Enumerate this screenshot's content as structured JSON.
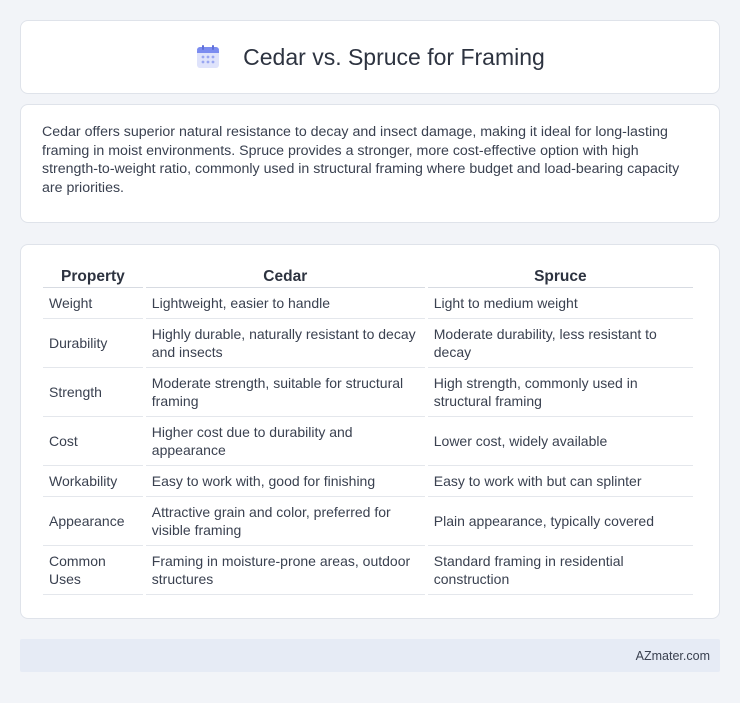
{
  "header": {
    "title": "Cedar vs. Spruce for Framing",
    "icon": "calendar-icon",
    "icon_colors": {
      "top": "#7b8cf0",
      "body": "#dfe3fb",
      "dots": "#9aa7f2"
    }
  },
  "summary": {
    "text": "Cedar offers superior natural resistance to decay and insect damage, making it ideal for long-lasting framing in moist environments. Spruce provides a stronger, more cost-effective option with high strength-to-weight ratio, commonly used in structural framing where budget and load-bearing capacity are priorities."
  },
  "table": {
    "headers": [
      "Property",
      "Cedar",
      "Spruce"
    ],
    "rows": [
      [
        "Weight",
        "Lightweight, easier to handle",
        "Light to medium weight"
      ],
      [
        "Durability",
        "Highly durable, naturally resistant to decay and insects",
        "Moderate durability, less resistant to decay"
      ],
      [
        "Strength",
        "Moderate strength, suitable for structural framing",
        "High strength, commonly used in structural framing"
      ],
      [
        "Cost",
        "Higher cost due to durability and appearance",
        "Lower cost, widely available"
      ],
      [
        "Workability",
        "Easy to work with, good for finishing",
        "Easy to work with but can splinter"
      ],
      [
        "Appearance",
        "Attractive grain and color, preferred for visible framing",
        "Plain appearance, typically covered"
      ],
      [
        "Common Uses",
        "Framing in moisture-prone areas, outdoor structures",
        "Standard framing in residential construction"
      ]
    ]
  },
  "footer": {
    "site": "AZmater.com"
  }
}
